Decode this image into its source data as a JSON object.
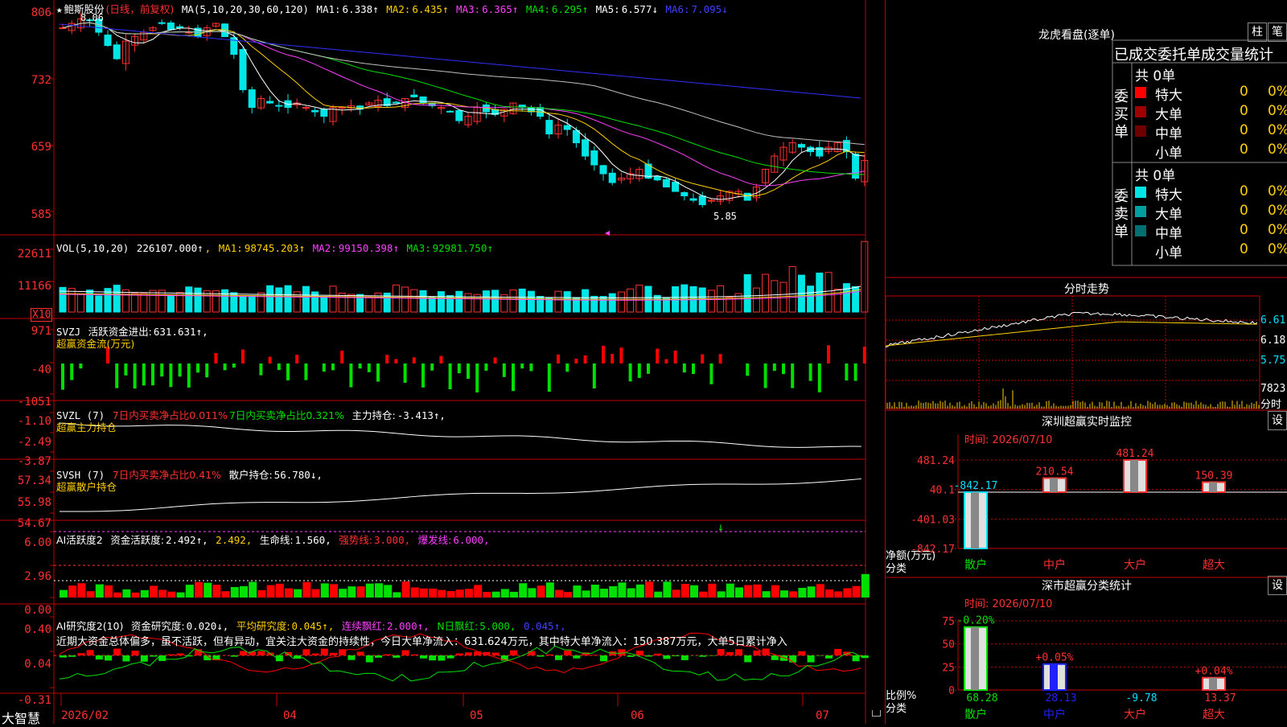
{
  "colors": {
    "up": "#ff3030",
    "down": "#00e6e6",
    "ma1": "#ffffff",
    "ma2": "#ffd000",
    "ma3": "#ff40ff",
    "ma4": "#00e000",
    "ma5": "#c0c0c0",
    "ma6": "#3030ff",
    "vol_ma1": "#ffffff",
    "vol_ma2": "#ffd000",
    "vol_ma3": "#ff40ff",
    "bg": "#000000",
    "border": "#c00000"
  },
  "price": {
    "title_star": "★",
    "name": "鲍斯股份",
    "mode": "(日线，前复权)",
    "ma_params": "MA(5,10,20,30,60,120)",
    "ma": [
      {
        "label": "MA1:",
        "value": "6.338↑"
      },
      {
        "label": "MA2:",
        "value": "6.435↑"
      },
      {
        "label": "MA3:",
        "value": "6.365↑"
      },
      {
        "label": "MA4:",
        "value": "6.295↑"
      },
      {
        "label": "MA5:",
        "value": "6.577↓"
      },
      {
        "label": "MA6:",
        "value": "7.095↓"
      }
    ],
    "y_labels": [
      "806",
      "732",
      "659",
      "585"
    ],
    "high_label": "8.06",
    "low_label": "5.85"
  },
  "volume": {
    "title": "VOL(5,10,20)",
    "value": "226107.000↑",
    "ma1_label": "MA1:",
    "ma1": "98745.203↑",
    "ma2_label": "MA2:",
    "ma2": "99150.398↑",
    "ma3_label": "MA3:",
    "ma3": "92981.750↑",
    "y_labels": [
      "22611",
      "11166"
    ],
    "unit": "X10"
  },
  "svzj": {
    "title": "SVZJ",
    "label": "活跃资金进出:",
    "value": "631.631↑,",
    "subtitle": "超赢资金流(万元)",
    "y_labels": [
      "971",
      "-40",
      "-1051"
    ]
  },
  "svzl": {
    "title": "SVZL (7)",
    "t1": "7日内买卖净占比0.011%",
    "t2": "7日内买卖净占比0.321%",
    "label": "主力持仓:",
    "value": "-3.413↑,",
    "subtitle": "超赢主力持仓",
    "y_labels": [
      "-1.10",
      "-2.49",
      "-3.87"
    ]
  },
  "svsh": {
    "title": "SVSH (7)",
    "t1": "7日内买卖净占比0.41%",
    "label": "散户持仓:",
    "value": "56.780↓,",
    "subtitle": "超赢散户持仓",
    "y_labels": [
      "57.34",
      "55.98",
      "54.67"
    ]
  },
  "ai1": {
    "title": "AI活跃度2",
    "l1": "资金活跃度:",
    "v1": "2.492↑,",
    "v2": "2.492,",
    "l3": "生命线:",
    "v3": "1.560,",
    "l4": "强势线:",
    "v4": "3.000,",
    "l5": "爆发线:",
    "v5": "6.000,",
    "y_labels": [
      "6.00",
      "2.96",
      "0.00"
    ]
  },
  "ai2": {
    "title": "AI研究度2(10)",
    "l1": "资金研究度:",
    "v1": "0.020↓,",
    "l2": "平均研究度:",
    "v2": "0.045↑,",
    "l3": "连续飘红:",
    "v3": "2.000↑,",
    "l4": "N日飘红:",
    "v4": "5.000,",
    "v5": "0.045↑,",
    "comment": "近期大资金总体偏多，虽不活跃，但有异动，宜关注大资金的持续性，今日大单净流入：631.624万元，其中特大单净流入：150.387万元，大单5日累计净入",
    "y_labels": [
      "0.40",
      "0.04",
      "-0.31"
    ]
  },
  "xaxis": {
    "brand": "大智慧",
    "dates": [
      "2026/02",
      "04",
      "05",
      "06",
      "07"
    ]
  },
  "longhu": {
    "title": "龙虎看盘(逐单)",
    "btn1": "柱",
    "btn2": "笔",
    "header": "已成交委托单成交量统计",
    "buy": {
      "side": "委买单",
      "total": "共 0单",
      "rows": [
        {
          "name": "特大",
          "count": "0",
          "pct": "0%"
        },
        {
          "name": "大单",
          "count": "0",
          "pct": "0%"
        },
        {
          "name": "中单",
          "count": "0",
          "pct": "0%"
        },
        {
          "name": "小单",
          "count": "0",
          "pct": "0%"
        }
      ]
    },
    "sell": {
      "side": "委卖单",
      "total": "共 0单",
      "rows": [
        {
          "name": "特大",
          "count": "0",
          "pct": "0%"
        },
        {
          "name": "大单",
          "count": "0",
          "pct": "0%"
        },
        {
          "name": "中单",
          "count": "0",
          "pct": "0%"
        },
        {
          "name": "小单",
          "count": "0",
          "pct": "0%"
        }
      ]
    }
  },
  "intraday": {
    "title": "分时走势",
    "y_labels": [
      "6.61",
      "6.18",
      "5.75"
    ],
    "vol_label": "7823",
    "unit": "分时"
  },
  "szmon": {
    "title": "深圳超赢实时监控",
    "btn": "设",
    "time": "时间: 2026/07/10",
    "y_labels": [
      "481.24",
      "40.1",
      "-401.03",
      "-842.17"
    ],
    "ylabel": "净额(万元)",
    "xlabel": "分类",
    "cats": [
      "散户",
      "中户",
      "大户",
      "超大"
    ],
    "vals": [
      "-842.17",
      "210.54",
      "481.24",
      "150.39"
    ]
  },
  "szcls": {
    "title": "深市超赢分类统计",
    "btn": "设",
    "time": "时间: 2026/07/10",
    "y_labels": [
      "75",
      "50",
      "25",
      "0"
    ],
    "ylabel": "比例%",
    "xlabel": "分类",
    "cats": [
      "散户",
      "中户",
      "大户",
      "超大"
    ],
    "top": [
      "-0.20%",
      "+0.05%",
      "",
      "+0.04%"
    ],
    "bottom": [
      "68.28",
      "28.13",
      "-9.78",
      "13.37"
    ]
  },
  "chart_data": [
    {
      "type": "candlestick",
      "title": "鲍斯股份",
      "ylim": [
        5.85,
        8.06
      ],
      "note": "daily K-line with MA5..MA120"
    },
    {
      "type": "bar",
      "title": "深圳超赢实时监控",
      "categories": [
        "散户",
        "中户",
        "大户",
        "超大"
      ],
      "values": [
        -842.17,
        210.54,
        481.24,
        150.39
      ],
      "ylabel": "净额(万元)"
    },
    {
      "type": "bar",
      "title": "深市超赢分类统计",
      "categories": [
        "散户",
        "中户",
        "大户",
        "超大"
      ],
      "values": [
        68.28,
        28.13,
        -9.78,
        13.37
      ],
      "ylim": [
        0,
        75
      ],
      "ylabel": "比例%"
    }
  ]
}
